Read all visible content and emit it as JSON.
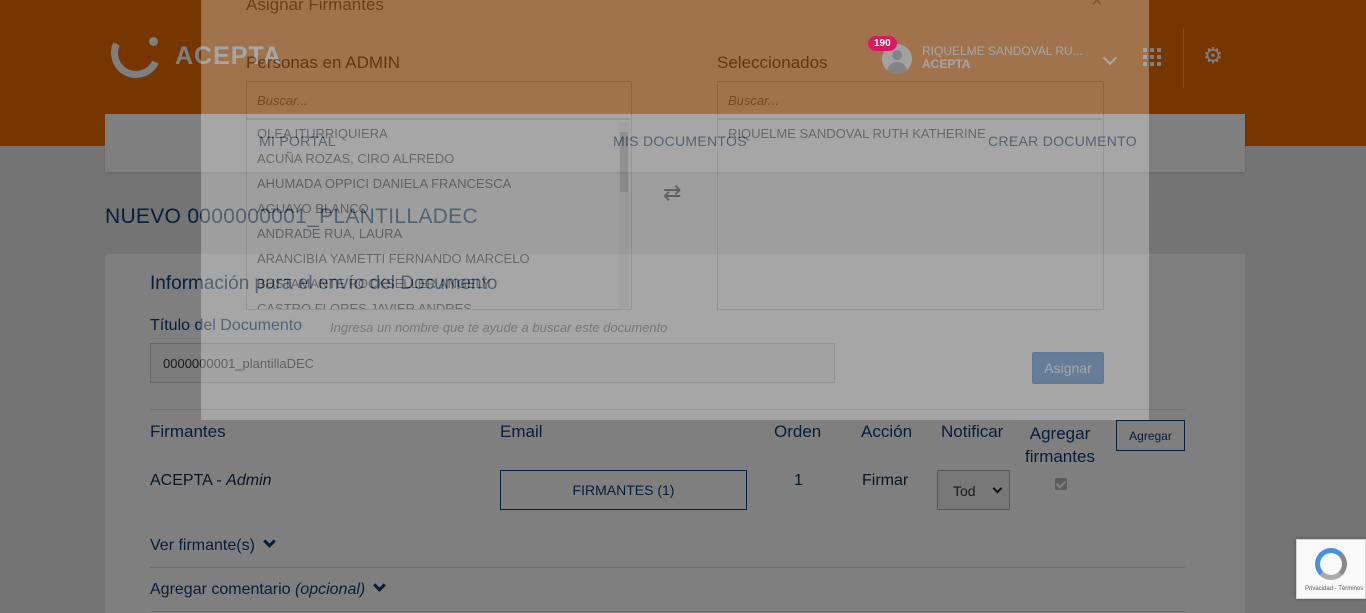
{
  "header": {
    "logo_text": "ACEPTA",
    "notifications_count": "190",
    "user_name": "RIQUELME SANDOVAL RU...",
    "user_company": "ACEPTA",
    "icons": [
      "apps-grid-icon",
      "gear-icon",
      "chevron-down-icon"
    ]
  },
  "nav": {
    "items": [
      "MI PORTAL",
      "MIS DOCUMENTOS",
      "CREAR DOCUMENTO"
    ]
  },
  "page": {
    "title": "NUEVO 0000000001_PLANTILLADEC"
  },
  "form": {
    "section_title": "Información para el envío del Documento",
    "doc_title_label": "Título del Documento",
    "doc_title_hint": "Ingresa un nombre que te ayude a buscar este documento",
    "doc_title_value": "0000000001_plantillaDEC",
    "columns": {
      "firmantes": "Firmantes",
      "email": "Email",
      "orden": "Orden",
      "accion": "Acción",
      "notificar": "Notificar",
      "agregar": "Agregar firmantes"
    },
    "add_button": "Agregar",
    "signer": {
      "company": "ACEPTA",
      "role": "Admin",
      "email_button": "FIRMANTES (1)",
      "order": "1",
      "action": "Firmar",
      "notify": "Tod"
    },
    "view_signers": "Ver firmante(s)",
    "add_comment": "Agregar comentario",
    "add_comment_optional": "(opcional)"
  },
  "modal": {
    "title": "Asignar Firmantes",
    "close": "×",
    "left_label": "Personas en ADMIN",
    "right_label": "Seleccionados",
    "search_placeholder": "Buscar...",
    "people": [
      "OLEA ITURRIQUIERA",
      "ACUÑA ROZAS, CIRO ALFREDO",
      "AHUMADA OPPICI DANIELA FRANCESCA",
      "AGUAYO BLANCO",
      "ANDRADE RUA, LAURA",
      "ARANCIBIA YAMETTI FERNANDO MARCELO",
      "BUSTAMANTE ROCKSELLER ANGELY",
      "CASTRO FLORES JAVIER ANDRES"
    ],
    "selected": [
      "RIQUELME SANDOVAL RUTH KATHERINE"
    ],
    "assign_button": "Asignar"
  },
  "recaptcha": {
    "text": "Privacidad - Términos"
  }
}
